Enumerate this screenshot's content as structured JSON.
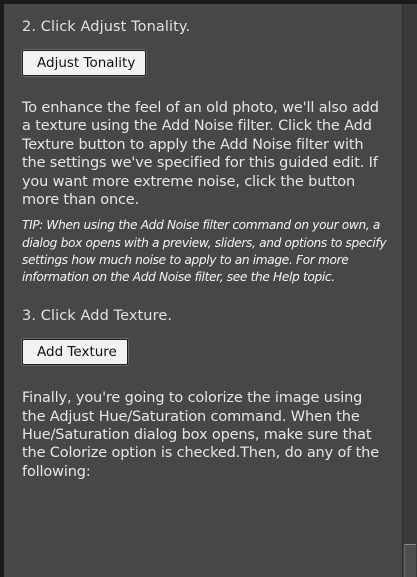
{
  "guide": {
    "step2_text": "2. Click Adjust Tonality.",
    "adjust_tonality_button": "Adjust Tonality",
    "texture_paragraph": "To enhance the feel of an old photo, we'll also add a texture using the Add Noise filter. Click the Add Texture button to apply the Add Noise filter with the settings we've specified for this guided edit. If you want more extreme noise, click the button more than once.",
    "tip": "TIP: When using the Add Noise filter command on your own, a dialog box opens with a preview, sliders, and options to specify settings how much noise to apply to an image. For more information on the Add Noise filter, see the Help topic.",
    "step3_text": "3. Click Add Texture.",
    "add_texture_button": "Add Texture",
    "colorize_paragraph": "Finally, you're going to colorize the image using the Adjust Hue/Saturation command. When the Hue/Saturation dialog box opens, make sure that the Colorize option is checked.Then, do any of the following:"
  }
}
